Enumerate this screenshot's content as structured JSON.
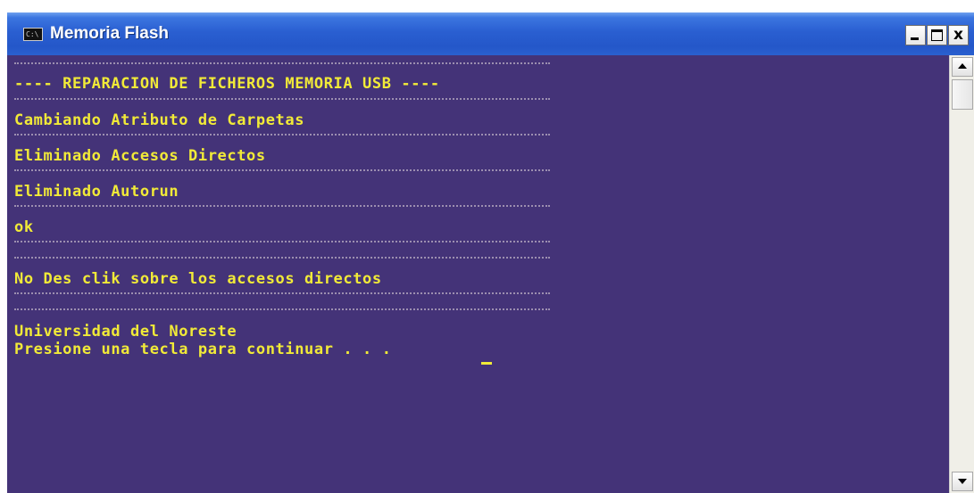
{
  "window": {
    "title": "Memoria Flash",
    "icon": "console-icon",
    "icon_text": "C:\\",
    "controls": {
      "minimize": "minimize-icon",
      "maximize": "maximize-icon",
      "close_label": "x"
    }
  },
  "console": {
    "background": "#443378",
    "text_color": "#f1ea38",
    "lines": [
      "---- REPARACION DE FICHEROS MEMORIA USB ----",
      "Cambiando Atributo de Carpetas",
      "Eliminado Accesos Directos",
      "Eliminado Autorun",
      "ok",
      "No Des clik sobre los accesos directos",
      "Universidad del Noreste",
      "Presione una tecla para continuar . . . "
    ]
  },
  "scrollbar": {
    "up": "scroll-up-arrow-icon",
    "down": "scroll-down-arrow-icon"
  }
}
